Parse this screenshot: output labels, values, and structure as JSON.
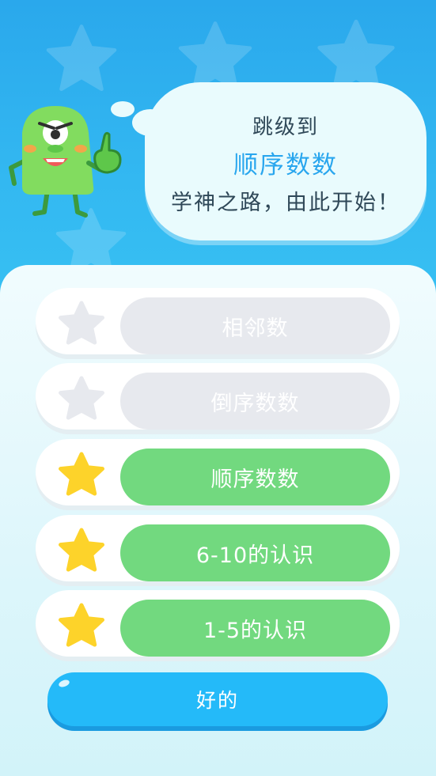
{
  "bubble": {
    "line1": "跳级到",
    "line2": "顺序数数",
    "line3": "学神之路，由此开始！"
  },
  "levels": [
    {
      "label": "相邻数",
      "status": "locked",
      "star_icon": "star-outline-icon"
    },
    {
      "label": "倒序数数",
      "status": "locked",
      "star_icon": "star-outline-icon"
    },
    {
      "label": "顺序数数",
      "status": "unlocked",
      "star_icon": "star-filled-icon"
    },
    {
      "label": "6-10的认识",
      "status": "unlocked",
      "star_icon": "star-filled-icon"
    },
    {
      "label": "1-5的认识",
      "status": "unlocked",
      "star_icon": "star-filled-icon"
    }
  ],
  "ok_button": {
    "label": "好的"
  },
  "colors": {
    "sky": "#2fb0ee",
    "accent_blue": "#29a6ee",
    "done_green": "#72d97f",
    "locked_gray": "#e7e9ee",
    "star_yellow": "#fdd32a",
    "button_blue": "#24baf9"
  },
  "mascot": {
    "icon": "green-monster-mascot"
  }
}
